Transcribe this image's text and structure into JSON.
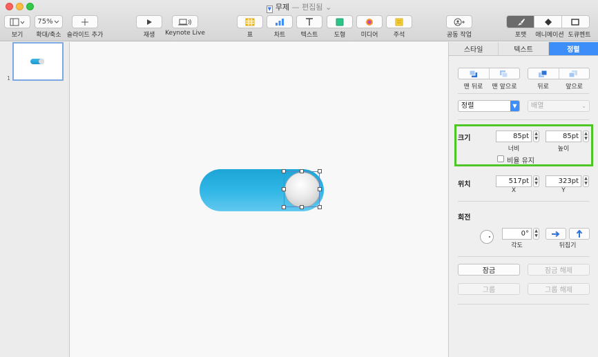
{
  "window": {
    "title": "무제",
    "separator": "—",
    "status": "편집됨",
    "status_chevron": "⌄"
  },
  "toolbar": {
    "view_label": "보기",
    "zoom_value": "75%",
    "zoom_label": "확대/축소",
    "add_slide_label": "슬라이드 추가",
    "play_label": "재생",
    "keynote_live_label": "Keynote Live",
    "table_label": "표",
    "chart_label": "차트",
    "text_label": "텍스트",
    "shape_label": "도형",
    "media_label": "미디어",
    "comment_label": "주석",
    "collaborate_label": "공동 작업",
    "format_label": "포맷",
    "animate_label": "애니메이션",
    "document_label": "도큐멘트",
    "accent_color": "#3d8ef8"
  },
  "navigator": {
    "slide_number": "1"
  },
  "inspector": {
    "tabs": [
      {
        "label": "스타일"
      },
      {
        "label": "텍스트"
      },
      {
        "label": "정렬"
      }
    ],
    "arrange": {
      "back_label": "맨 뒤로",
      "front_label": "맨 앞으로",
      "backward_label": "뒤로",
      "forward_label": "앞으로",
      "align_value": "정렬",
      "distribute_value": "배열"
    },
    "size": {
      "title": "크기",
      "width_value": "85pt",
      "height_value": "85pt",
      "width_label": "너비",
      "height_label": "높이",
      "constrain_label": "비율 유지",
      "highlight_color": "#4ec726"
    },
    "position": {
      "title": "위치",
      "x_value": "517pt",
      "y_value": "323pt",
      "x_label": "X",
      "y_label": "Y"
    },
    "rotate": {
      "title": "회전",
      "angle_value": "0°",
      "angle_label": "각도",
      "flip_label": "뒤집기"
    },
    "lock": {
      "lock_label": "잠금",
      "unlock_label": "잠금 해제",
      "group_label": "그룹",
      "ungroup_label": "그룹 해제"
    }
  }
}
